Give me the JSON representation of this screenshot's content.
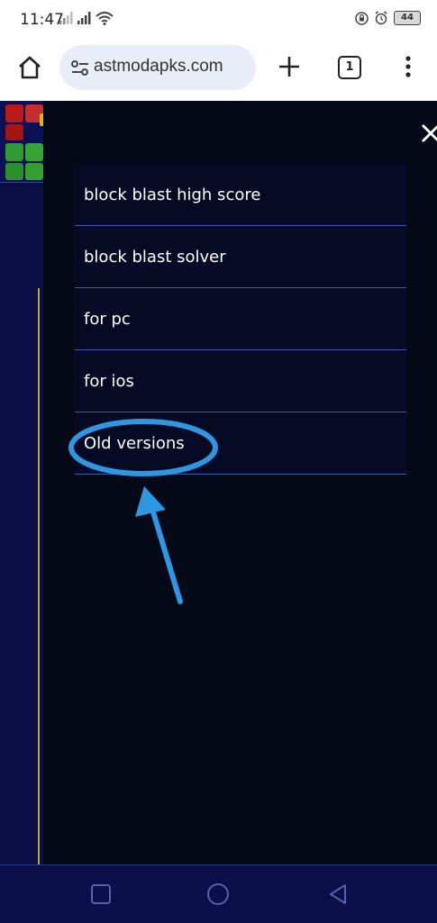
{
  "status_bar": {
    "time": "11:47",
    "battery": "44"
  },
  "browser": {
    "url": "astmodapks.com",
    "tab_count": "1"
  },
  "menu": {
    "items": [
      {
        "label": "block blast high score"
      },
      {
        "label": "block blast solver"
      },
      {
        "label": "for pc"
      },
      {
        "label": "for ios"
      },
      {
        "label": "Old versions"
      }
    ]
  },
  "colors": {
    "page_background": "#0a0e45",
    "menu_panel": "#050918",
    "menu_divider": "#3c5ca8",
    "annotation": "#2f96e0"
  },
  "icons": {
    "home": "home-icon",
    "site_settings": "site-settings-icon",
    "add_tab": "plus-icon",
    "overflow": "more-vert-icon",
    "close": "close-icon",
    "nav_recents": "square-icon",
    "nav_home": "circle-icon",
    "nav_back": "triangle-back-icon"
  }
}
